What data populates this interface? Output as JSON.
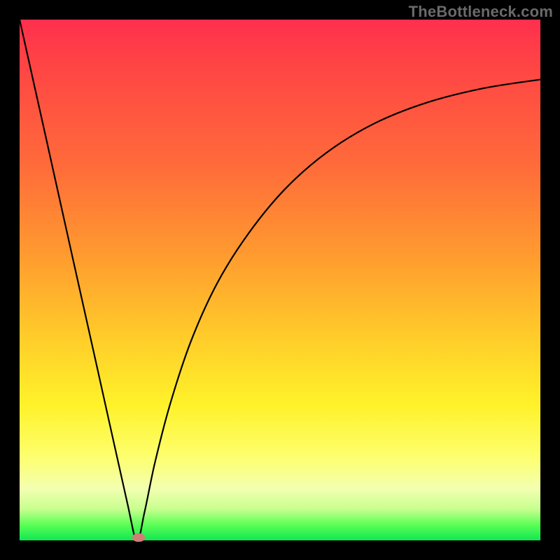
{
  "watermark": "TheBottleneck.com",
  "chart_data": {
    "type": "line",
    "title": "",
    "xlabel": "",
    "ylabel": "",
    "x_range": [
      0,
      100
    ],
    "y_range": [
      0,
      100
    ],
    "grid": false,
    "legend": false,
    "series": [
      {
        "name": "curve",
        "x": [
          0.0,
          5.0,
          10.0,
          15.0,
          20.5,
          22.5,
          24.0,
          26.0,
          29.0,
          33.0,
          38.0,
          44.0,
          51.0,
          59.0,
          68.0,
          78.0,
          89.0,
          100.0
        ],
        "y": [
          100.0,
          77.6,
          55.1,
          32.7,
          8.0,
          0.0,
          5.5,
          15.0,
          26.5,
          38.5,
          49.5,
          59.0,
          67.5,
          74.5,
          80.0,
          84.0,
          86.8,
          88.5
        ]
      }
    ],
    "marker": {
      "x": 22.8,
      "y": 0.5,
      "color": "#d17d76"
    },
    "background_gradient_stops": [
      {
        "pos": 0,
        "color": "#ff2f4e"
      },
      {
        "pos": 8,
        "color": "#ff4345"
      },
      {
        "pos": 28,
        "color": "#ff6b3a"
      },
      {
        "pos": 45,
        "color": "#ff9a2f"
      },
      {
        "pos": 60,
        "color": "#ffc92a"
      },
      {
        "pos": 74,
        "color": "#fff22a"
      },
      {
        "pos": 84,
        "color": "#fdff6e"
      },
      {
        "pos": 90,
        "color": "#f3ffb0"
      },
      {
        "pos": 94,
        "color": "#c7ff8f"
      },
      {
        "pos": 97,
        "color": "#5bff55"
      },
      {
        "pos": 100,
        "color": "#11e653"
      }
    ]
  }
}
